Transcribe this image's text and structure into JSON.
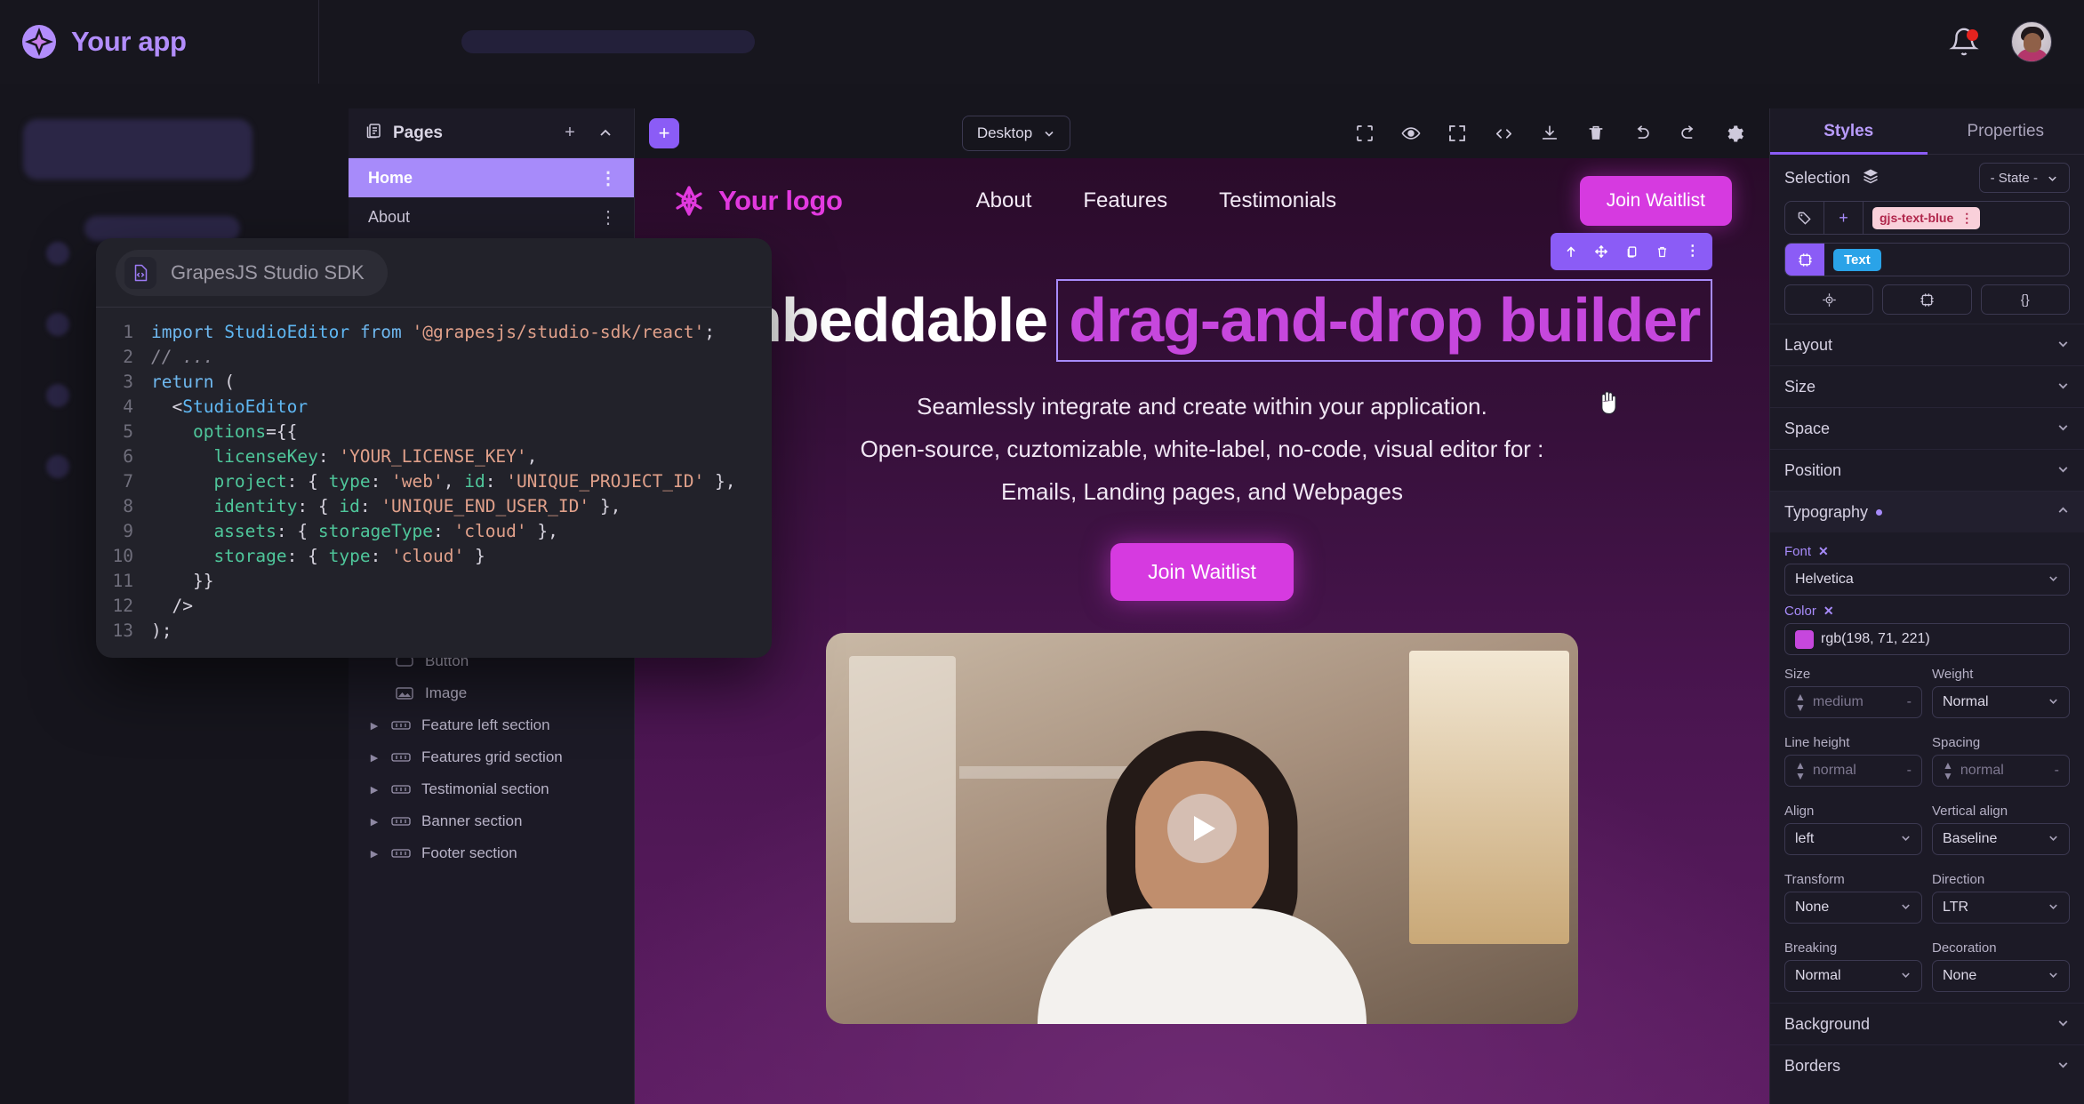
{
  "topbar": {
    "app_name": "Your app",
    "logo_icon": "sparkle-logo-icon",
    "bell_icon": "notification-bell-icon",
    "avatar_icon": "user-avatar"
  },
  "left_panel": {
    "pages_header": {
      "icon": "pages-icon",
      "title": "Pages",
      "add_label": "+",
      "collapse_label": "⌃"
    },
    "pages": [
      {
        "label": "Home",
        "active": true,
        "menu": "⋮"
      },
      {
        "label": "About",
        "active": false,
        "menu": "⋮"
      }
    ],
    "layers": [
      {
        "label": "Button",
        "icon": "button-icon",
        "indent": 2,
        "caret": ""
      },
      {
        "label": "Image",
        "icon": "image-icon",
        "indent": 2,
        "caret": ""
      },
      {
        "label": "Feature left section",
        "icon": "section-icon",
        "indent": 1,
        "caret": "▶"
      },
      {
        "label": "Features grid section",
        "icon": "section-icon",
        "indent": 1,
        "caret": "▶"
      },
      {
        "label": "Testimonial section",
        "icon": "section-icon",
        "indent": 1,
        "caret": "▶"
      },
      {
        "label": "Banner section",
        "icon": "section-icon",
        "indent": 1,
        "caret": "▶"
      },
      {
        "label": "Footer section",
        "icon": "section-icon",
        "indent": 1,
        "caret": "▶"
      }
    ]
  },
  "canvas_toolbar": {
    "add_block_label": "+",
    "device": "Desktop",
    "icons": [
      "fullscreen-borders-icon",
      "preview-eye-icon",
      "fullscreen-icon",
      "code-icon",
      "download-icon",
      "trash-icon",
      "undo-icon",
      "redo-icon",
      "settings-gear-icon"
    ]
  },
  "site": {
    "logo_text": "Your logo",
    "logo_icon": "asterisk-logo-icon",
    "nav_links": [
      "About",
      "Features",
      "Testimonials"
    ],
    "nav_cta": "Join Waitlist",
    "hero_heading_plain": "embeddable",
    "hero_heading_selected": "drag-and-drop builder",
    "hero_sub_lines": [
      "Seamlessly integrate and create within your application.",
      "Open-source, cuztomizable, white-label, no-code, visual editor for :",
      "Emails, Landing pages, and Webpages"
    ],
    "hero_cta": "Join Waitlist",
    "selection_toolbar_icons": [
      "select-parent-arrow-icon",
      "move-icon",
      "copy-icon",
      "delete-icon",
      "more-options-icon"
    ],
    "cursor_icon": "grab-hand-cursor",
    "media_play_icon": "play-button-icon"
  },
  "right_panel": {
    "tabs": [
      {
        "label": "Styles",
        "active": true
      },
      {
        "label": "Properties",
        "active": false
      }
    ],
    "selection_label": "Selection",
    "selection_icon": "layers-stack-icon",
    "state_label": "- State -",
    "class_row": {
      "tag_icon": "tag-icon",
      "add_label": "+",
      "chip": "gjs-text-blue",
      "chip_menu": "⋮"
    },
    "component_row": {
      "component_icon": "component-icon",
      "chip": "Text"
    },
    "icon_row": [
      "target-icon",
      "component-icon",
      "code-braces-icon"
    ],
    "sections": [
      {
        "label": "Layout",
        "open": false,
        "dot": false
      },
      {
        "label": "Size",
        "open": false,
        "dot": false
      },
      {
        "label": "Space",
        "open": false,
        "dot": false
      },
      {
        "label": "Position",
        "open": false,
        "dot": false
      },
      {
        "label": "Typography",
        "open": true,
        "dot": true
      },
      {
        "label": "Background",
        "open": false,
        "dot": false
      },
      {
        "label": "Borders",
        "open": false,
        "dot": false
      }
    ],
    "typography": {
      "font_label": "Font",
      "font_value": "Helvetica",
      "color_label": "Color",
      "color_value": "rgb(198, 71, 221)",
      "color_hex": "#c647dd",
      "size_label": "Size",
      "size_value": "medium",
      "weight_label": "Weight",
      "weight_value": "Normal",
      "line_height_label": "Line height",
      "line_height_value": "normal",
      "spacing_label": "Spacing",
      "spacing_value": "normal",
      "align_label": "Align",
      "align_value": "left",
      "valign_label": "Vertical align",
      "valign_value": "Baseline",
      "transform_label": "Transform",
      "transform_value": "None",
      "direction_label": "Direction",
      "direction_value": "LTR",
      "breaking_label": "Breaking",
      "breaking_value": "Normal",
      "decoration_label": "Decoration",
      "decoration_value": "None"
    }
  },
  "code_card": {
    "chip_icon": "code-file-icon",
    "chip_title": "GrapesJS Studio SDK",
    "lines": [
      {
        "n": "1",
        "segs": [
          [
            "kw",
            "import "
          ],
          [
            "cls",
            "StudioEditor"
          ],
          [
            "kw",
            " from "
          ],
          [
            "str",
            "'@grapesjs/studio-sdk/react'"
          ],
          [
            "op",
            ";"
          ]
        ]
      },
      {
        "n": "2",
        "segs": [
          [
            "cm",
            "// ..."
          ]
        ]
      },
      {
        "n": "3",
        "segs": [
          [
            "kw",
            "return"
          ],
          [
            "op",
            " ("
          ]
        ]
      },
      {
        "n": "4",
        "segs": [
          [
            "op",
            "  <"
          ],
          [
            "cls",
            "StudioEditor"
          ]
        ]
      },
      {
        "n": "5",
        "segs": [
          [
            "prop",
            "    options"
          ],
          [
            "op",
            "={{"
          ]
        ]
      },
      {
        "n": "6",
        "segs": [
          [
            "prop",
            "      licenseKey"
          ],
          [
            "op",
            ": "
          ],
          [
            "str",
            "'YOUR_LICENSE_KEY'"
          ],
          [
            "op",
            ","
          ]
        ]
      },
      {
        "n": "7",
        "segs": [
          [
            "prop",
            "      project"
          ],
          [
            "op",
            ": { "
          ],
          [
            "prop",
            "type"
          ],
          [
            "op",
            ": "
          ],
          [
            "str",
            "'web'"
          ],
          [
            "op",
            ", "
          ],
          [
            "prop",
            "id"
          ],
          [
            "op",
            ": "
          ],
          [
            "str",
            "'UNIQUE_PROJECT_ID'"
          ],
          [
            "op",
            " },"
          ]
        ]
      },
      {
        "n": "8",
        "segs": [
          [
            "prop",
            "      identity"
          ],
          [
            "op",
            ": { "
          ],
          [
            "prop",
            "id"
          ],
          [
            "op",
            ": "
          ],
          [
            "str",
            "'UNIQUE_END_USER_ID'"
          ],
          [
            "op",
            " },"
          ]
        ]
      },
      {
        "n": "9",
        "segs": [
          [
            "prop",
            "      assets"
          ],
          [
            "op",
            ": { "
          ],
          [
            "prop",
            "storageType"
          ],
          [
            "op",
            ": "
          ],
          [
            "str",
            "'cloud'"
          ],
          [
            "op",
            " },"
          ]
        ]
      },
      {
        "n": "10",
        "segs": [
          [
            "prop",
            "      storage"
          ],
          [
            "op",
            ": { "
          ],
          [
            "prop",
            "type"
          ],
          [
            "op",
            ": "
          ],
          [
            "str",
            "'cloud'"
          ],
          [
            "op",
            " }"
          ]
        ]
      },
      {
        "n": "11",
        "segs": [
          [
            "op",
            "    }}"
          ]
        ]
      },
      {
        "n": "12",
        "segs": [
          [
            "op",
            "  />"
          ]
        ]
      },
      {
        "n": "13",
        "segs": [
          [
            "op",
            ");"
          ]
        ]
      }
    ]
  }
}
